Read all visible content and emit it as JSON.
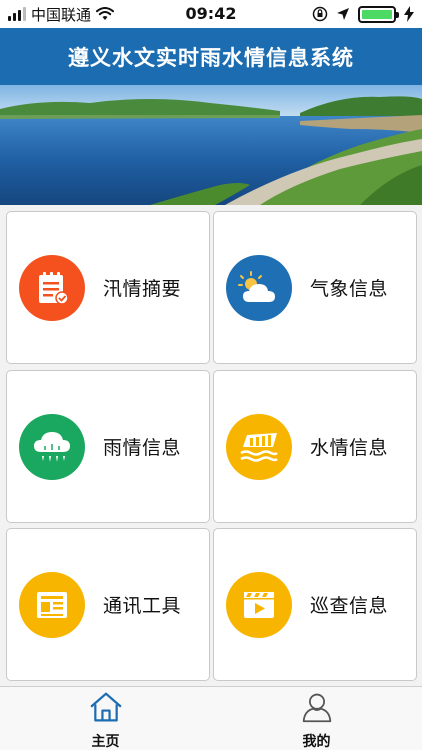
{
  "status_bar": {
    "carrier": "中国联通",
    "time": "09:42"
  },
  "header": {
    "title": "遵义水文实时雨水情信息系统"
  },
  "menu": {
    "items": [
      {
        "label": "汛情摘要",
        "icon": "notepad-icon",
        "color": "#f4511e"
      },
      {
        "label": "气象信息",
        "icon": "weather-cloud-sun-icon",
        "color": "#1e6fb3"
      },
      {
        "label": "雨情信息",
        "icon": "rain-cloud-icon",
        "color": "#1aa860"
      },
      {
        "label": "水情信息",
        "icon": "water-level-icon",
        "color": "#f7b500"
      },
      {
        "label": "通讯工具",
        "icon": "newspaper-icon",
        "color": "#f7b500"
      },
      {
        "label": "巡查信息",
        "icon": "video-play-icon",
        "color": "#f7b500"
      }
    ]
  },
  "tabbar": {
    "home_label": "主页",
    "mine_label": "我的",
    "active_color": "#1b6cb0"
  }
}
